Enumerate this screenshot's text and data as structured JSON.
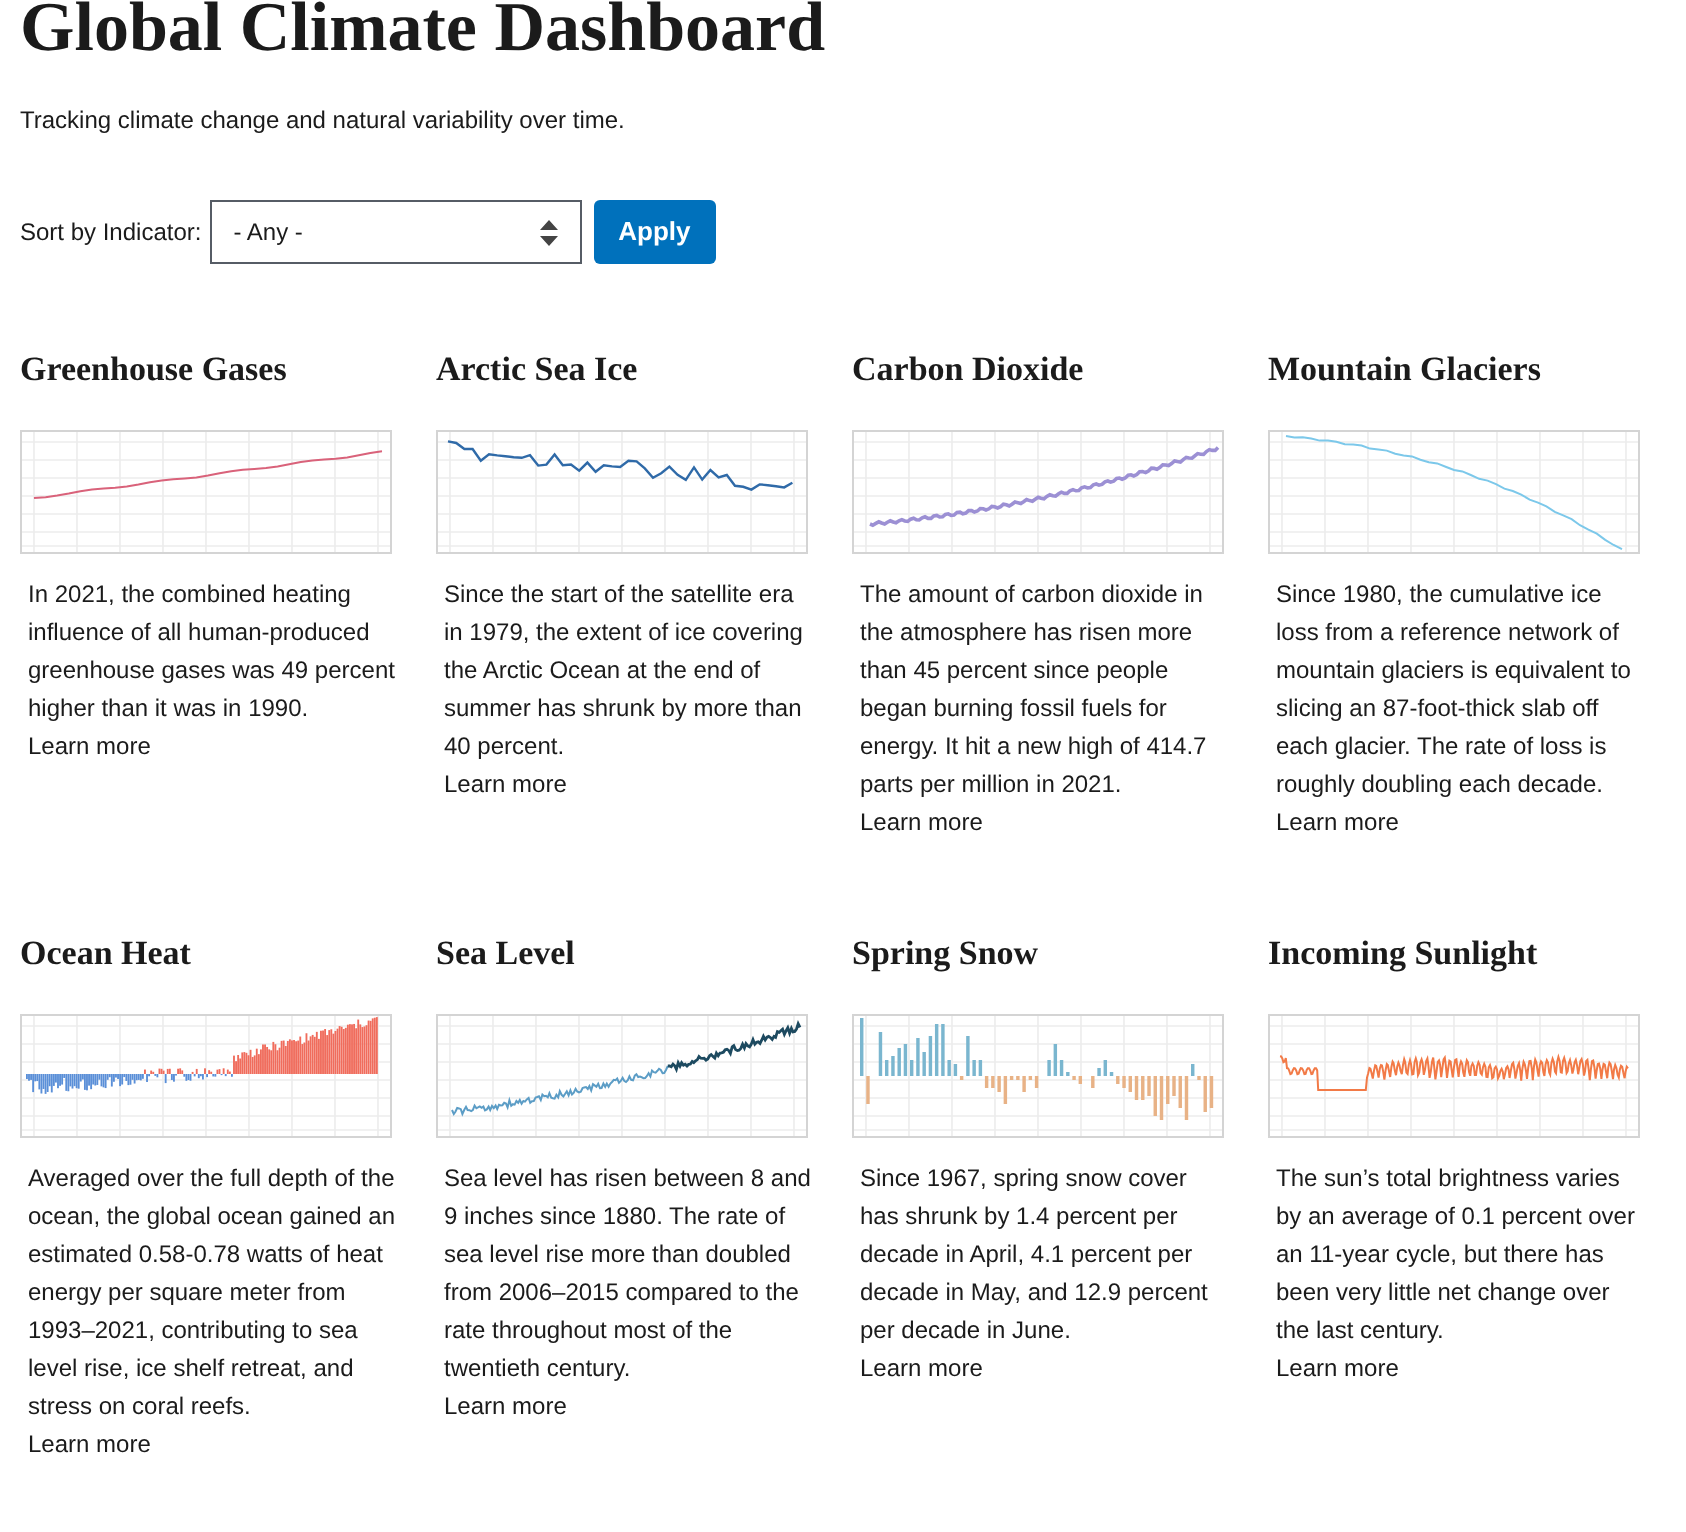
{
  "page": {
    "title": "Global Climate Dashboard",
    "subtitle": "Tracking climate change and natural variability over time."
  },
  "filter": {
    "label": "Sort by Indicator:",
    "value": "- Any -",
    "button": "Apply"
  },
  "indicators": [
    {
      "title": "Greenhouse Gases",
      "kind": "steady",
      "text": "In 2021, the combined heating influence of all human-produced greenhouse gases was 49 percent higher than it was in 1990.",
      "link": "Learn more"
    },
    {
      "title": "Arctic Sea Ice",
      "kind": "jagged",
      "text": "Since the start of the satellite era in 1979, the extent of ice covering the Arctic Ocean at the end of summer has shrunk by more than 40 percent.",
      "link": "Learn more"
    },
    {
      "title": "Carbon Dioxide",
      "kind": "curve",
      "text": "The amount of carbon dioxide in the atmosphere has risen more than 45 percent since people began burning fossil fuels for energy. It hit a new high of 414.7 parts per million in 2021.",
      "link": "Learn more"
    },
    {
      "title": "Mountain Glaciers",
      "kind": "decline",
      "text": "Since 1980, the cumulative ice loss from a reference network of mountain glaciers is equivalent to slicing an 87-foot-thick slab off each glacier. The rate of loss is roughly doubling each decade.",
      "link": "Learn more"
    },
    {
      "title": "Ocean Heat",
      "kind": "warming",
      "text": "Averaged over the full depth of the ocean, the global ocean gained an estimated 0.58-0.78 watts of heat energy per square meter from 1993–2021, contributing to sea level rise, ice shelf retreat, and stress on coral reefs.",
      "link": "Learn more"
    },
    {
      "title": "Sea Level",
      "kind": "sealevel",
      "text": "Sea level has risen between 8 and 9 inches since 1880. The rate of sea level rise more than doubled from 2006–2015 compared to the rate throughout most of the twentieth century.",
      "link": "Learn more"
    },
    {
      "title": "Spring Snow",
      "kind": "snow",
      "text": "Since 1967, spring snow cover has shrunk by 1.4 percent per decade in April, 4.1 percent per decade in May, and 12.9 percent per decade in June.",
      "link": "Learn more"
    },
    {
      "title": "Incoming Sunlight",
      "kind": "solar",
      "text": "The sun’s total brightness varies by an average of 0.1 percent over an 11-year cycle, but there has been very little net change over the last century.",
      "link": "Learn more"
    }
  ]
}
